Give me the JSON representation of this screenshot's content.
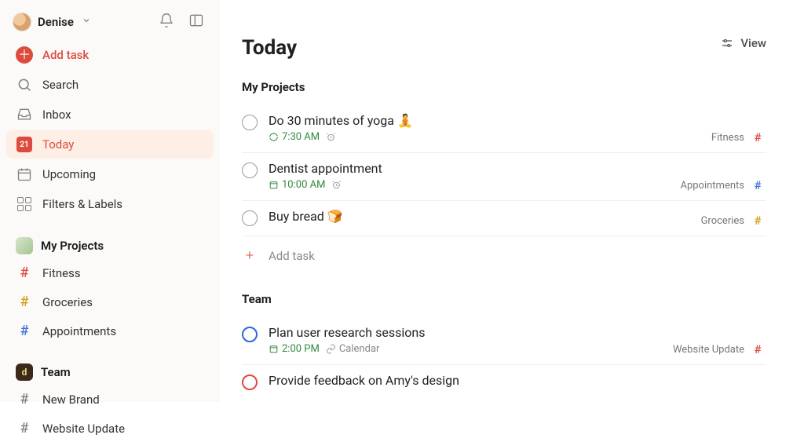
{
  "header": {
    "user_name": "Denise",
    "notification_icon": "bell-icon",
    "layout_icon": "panel-icon"
  },
  "sidebar": {
    "add_task_label": "Add task",
    "nav": [
      {
        "key": "search",
        "label": "Search",
        "icon": "magnifier-icon"
      },
      {
        "key": "inbox",
        "label": "Inbox",
        "icon": "tray-icon"
      },
      {
        "key": "today",
        "label": "Today",
        "icon": "calendar-today-icon",
        "badge": "21",
        "active": true
      },
      {
        "key": "upcoming",
        "label": "Upcoming",
        "icon": "calendar-upcoming-icon"
      },
      {
        "key": "filters",
        "label": "Filters & Labels",
        "icon": "grid-icon"
      }
    ],
    "my_projects": {
      "title": "My Projects",
      "items": [
        {
          "label": "Fitness",
          "color": "red"
        },
        {
          "label": "Groceries",
          "color": "yellow"
        },
        {
          "label": "Appointments",
          "color": "blue"
        }
      ]
    },
    "team": {
      "title": "Team",
      "avatar_letter": "d",
      "items": [
        {
          "label": "New Brand",
          "color": "grey"
        },
        {
          "label": "Website Update",
          "color": "grey"
        }
      ]
    }
  },
  "main": {
    "view_label": "View",
    "page_title": "Today",
    "sections": [
      {
        "title": "My Projects",
        "tasks": [
          {
            "title": "Do 30 minutes of yoga 🧘",
            "time": "7:30 AM",
            "time_icon": "recurring-icon",
            "extra_icon": "alarm-icon",
            "project": "Fitness",
            "project_color": "red",
            "priority": "none"
          },
          {
            "title": "Dentist appointment",
            "time": "10:00 AM",
            "time_icon": "calendar-small-icon",
            "extra_icon": "alarm-icon",
            "project": "Appointments",
            "project_color": "blue",
            "priority": "none"
          },
          {
            "title": "Buy bread 🍞",
            "time": "",
            "project": "Groceries",
            "project_color": "yellow",
            "priority": "none"
          }
        ],
        "add_task_label": "Add task"
      },
      {
        "title": "Team",
        "tasks": [
          {
            "title": "Plan user research sessions",
            "time": "2:00 PM",
            "time_icon": "calendar-small-icon",
            "extra_label": "Calendar",
            "extra_icon": "link-icon",
            "project": "Website Update",
            "project_color": "red",
            "priority": "blue"
          },
          {
            "title": "Provide feedback on Amy's design",
            "priority": "red"
          }
        ]
      }
    ]
  },
  "colors": {
    "accent": "#dc4c3e",
    "green": "#2e8b3d",
    "blue": "#4073d6",
    "yellow": "#d4a017"
  }
}
